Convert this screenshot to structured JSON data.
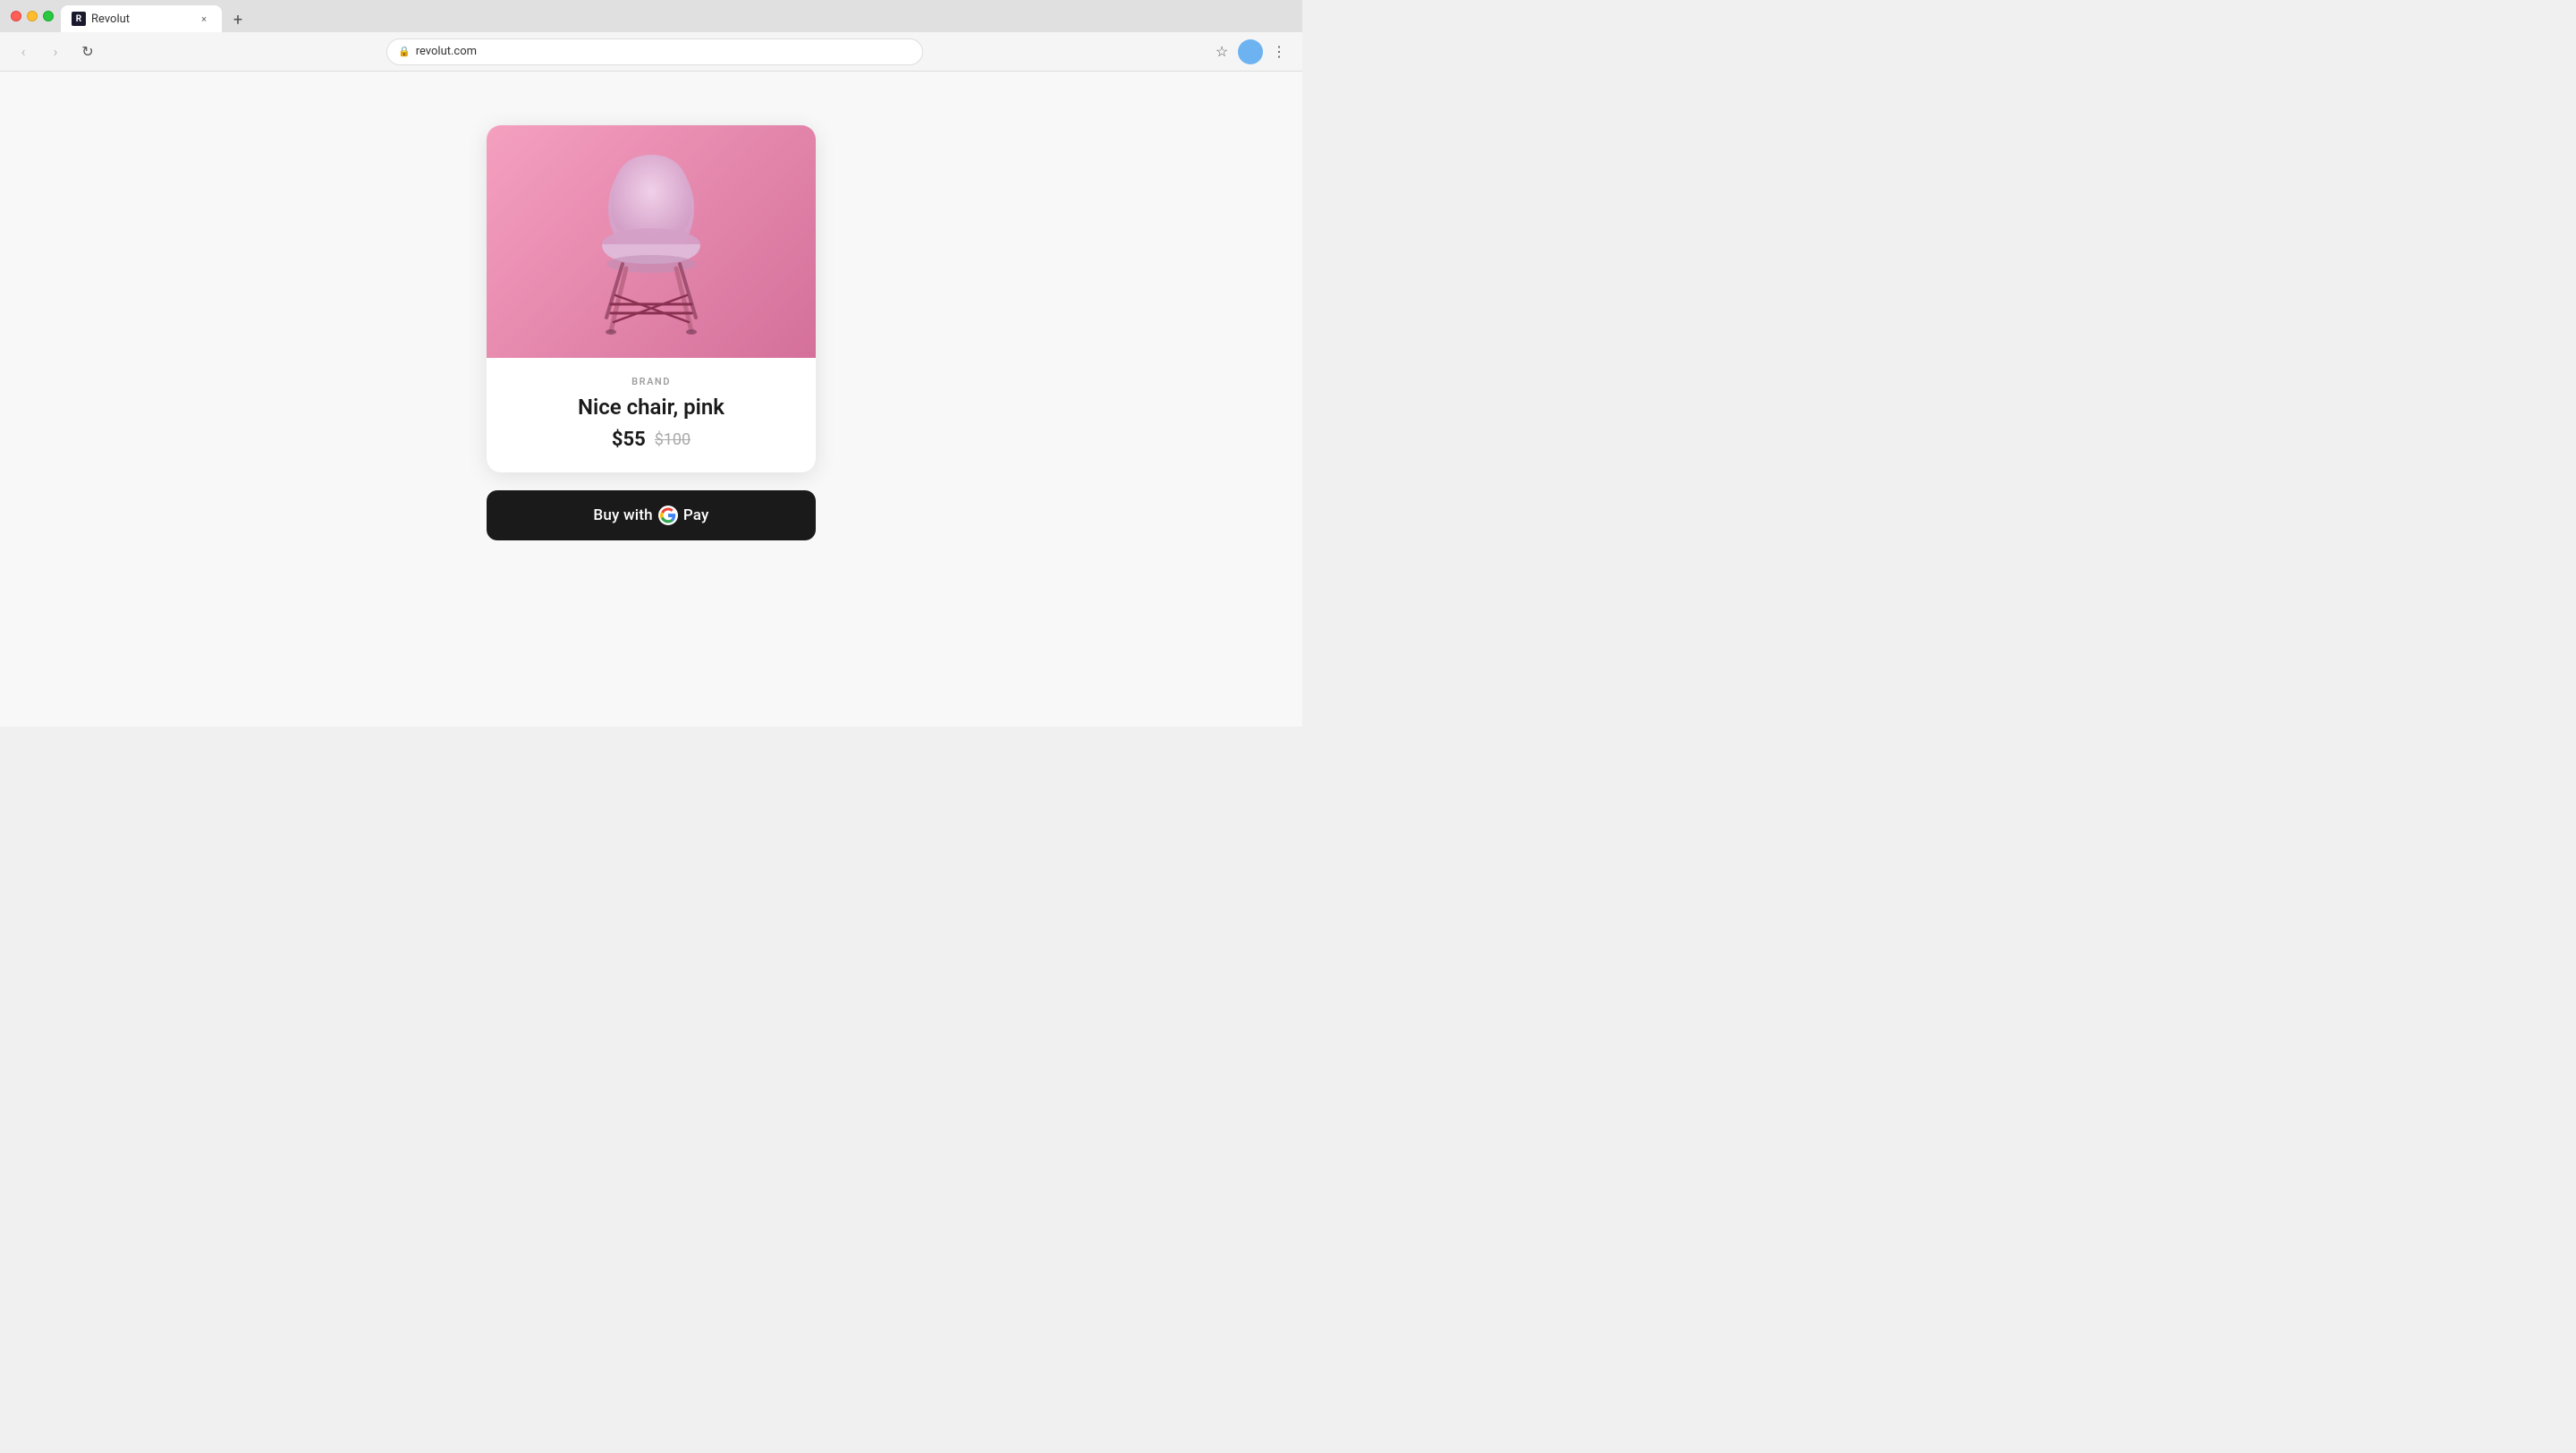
{
  "browser": {
    "tab_title": "Revolut",
    "tab_favicon_letter": "R",
    "url": "revolut.com",
    "new_tab_label": "+",
    "nav": {
      "back_label": "‹",
      "forward_label": "›",
      "refresh_label": "↻"
    }
  },
  "product": {
    "brand": "BRAND",
    "name": "Nice chair, pink",
    "current_price": "$55",
    "original_price": "$100"
  },
  "buy_button": {
    "prefix_text": "Buy with",
    "suffix_text": "Pay"
  }
}
